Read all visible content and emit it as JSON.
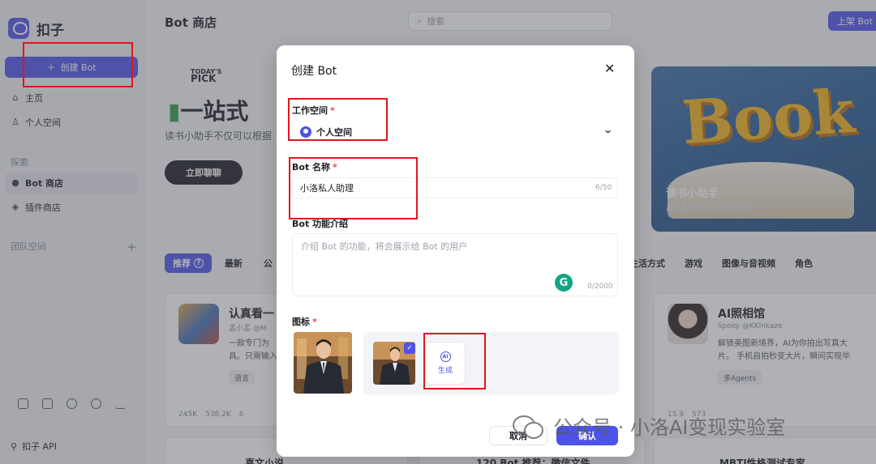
{
  "app": {
    "name": "扣子"
  },
  "sidebar": {
    "create_label": "创建 Bot",
    "items": [
      {
        "label": "主页",
        "icon": "home-icon"
      },
      {
        "label": "个人空间",
        "icon": "person-icon"
      }
    ],
    "explore_label": "探索",
    "explore_items": [
      {
        "label": "Bot 商店",
        "icon": "bot-icon"
      },
      {
        "label": "插件商店",
        "icon": "plugin-icon"
      }
    ],
    "team_label": "团队空间",
    "api_label": "扣子 API"
  },
  "header": {
    "title": "Bot 商店",
    "search_placeholder": "搜索",
    "publish_label": "上架 Bot"
  },
  "banner": {
    "badge_small": "TODAY'S",
    "badge_big": "PICK",
    "heading": "一站式",
    "subtitle": "读书小助手不仅可以根据",
    "cta": "立即聊聊",
    "feature_word": "Book",
    "feature_name": "读书小助手",
    "feature_author": "孟小孟 @Meng_dreamfly"
  },
  "categories": {
    "left": [
      "推荐",
      "最新",
      "公"
    ],
    "right": [
      "生活方式",
      "游戏",
      "图像与音视频",
      "角色"
    ]
  },
  "cards": [
    {
      "title": "认真看一",
      "author": "孟小孟 @M",
      "desc_lines": [
        "一款专门为",
        "具。只需输入"
      ],
      "tag": "语言",
      "stats": [
        "245K",
        "538.2K",
        "6"
      ]
    },
    {
      "title": "AI照相馆",
      "author": "lipeiqi @KKinkaze",
      "desc_lines": [
        "解锁美图新境界，AI为你拍出写真大",
        "片。 手机自拍秒变大片，瞬间实现毕"
      ],
      "tag": "多Agents",
      "stats": [
        "15.9",
        "573",
        ""
      ]
    }
  ],
  "bottom_cards": [
    "喜文小说",
    "120 Bot 推荐：微信文件",
    "MBTI性格测试专家"
  ],
  "modal": {
    "title": "创建 Bot",
    "workspace_label": "工作空间",
    "workspace_value": "个人空间",
    "name_label": "Bot 名称",
    "name_value": "小洛私人助理",
    "name_counter": "6/50",
    "desc_label": "Bot 功能介绍",
    "desc_placeholder": "介绍 Bot 的功能，将会展示给 Bot 的用户",
    "desc_counter": "0/2000",
    "icon_label": "图标",
    "generate_label": "生成",
    "generate_badge": "AI",
    "cancel_label": "取消",
    "confirm_label": "确认"
  },
  "watermark": "公众号 · 小洛AI变现实验室"
}
